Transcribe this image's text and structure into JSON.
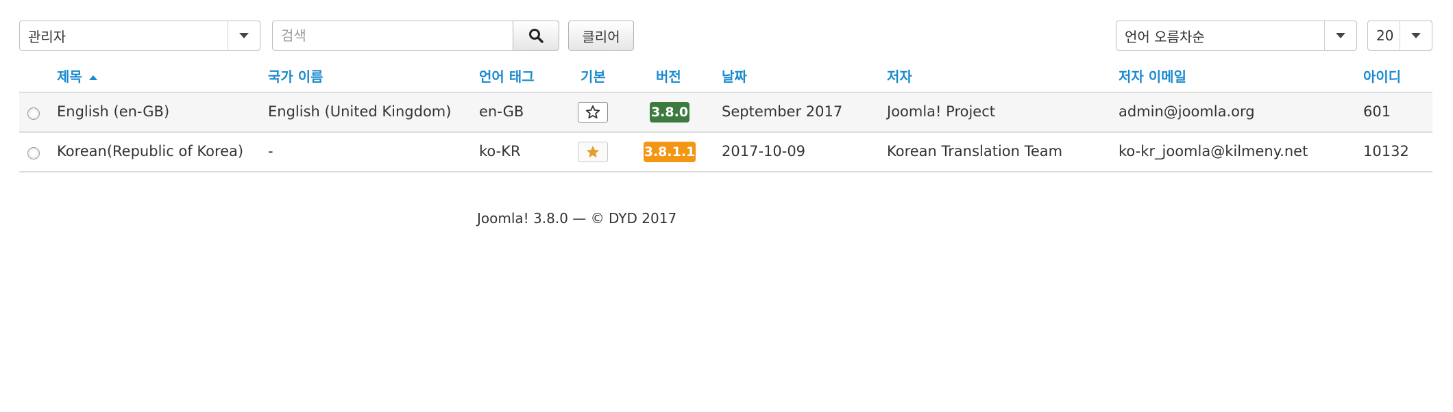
{
  "toolbar": {
    "client_filter": "관리자",
    "search_placeholder": "검색",
    "clear_label": "클리어",
    "sort_value": "언어 오름차순",
    "limit_value": "20"
  },
  "table": {
    "headers": {
      "title": "제목",
      "country": "국가 이름",
      "tag": "언어 태그",
      "default": "기본",
      "version": "버전",
      "date": "날짜",
      "author": "저자",
      "email": "저자 이메일",
      "id": "아이디"
    },
    "rows": [
      {
        "title": "English (en-GB)",
        "country": "English (United Kingdom)",
        "tag": "en-GB",
        "is_default": false,
        "version": "3.8.0",
        "version_color": "#3d7a3f",
        "date": "September 2017",
        "author": "Joomla! Project",
        "email": "admin@joomla.org",
        "id": "601"
      },
      {
        "title": "Korean(Republic of Korea)",
        "country": "-",
        "tag": "ko-KR",
        "is_default": true,
        "version": "3.8.1.1",
        "version_color": "#f29613",
        "date": "2017-10-09",
        "author": "Korean Translation Team",
        "email": "ko-kr_joomla@kilmeny.net",
        "id": "10132"
      }
    ]
  },
  "footer": {
    "text": "Joomla! 3.8.0 — © DYD 2017"
  },
  "colors": {
    "link": "#1a8ad0",
    "star_default": "#e0a030"
  }
}
